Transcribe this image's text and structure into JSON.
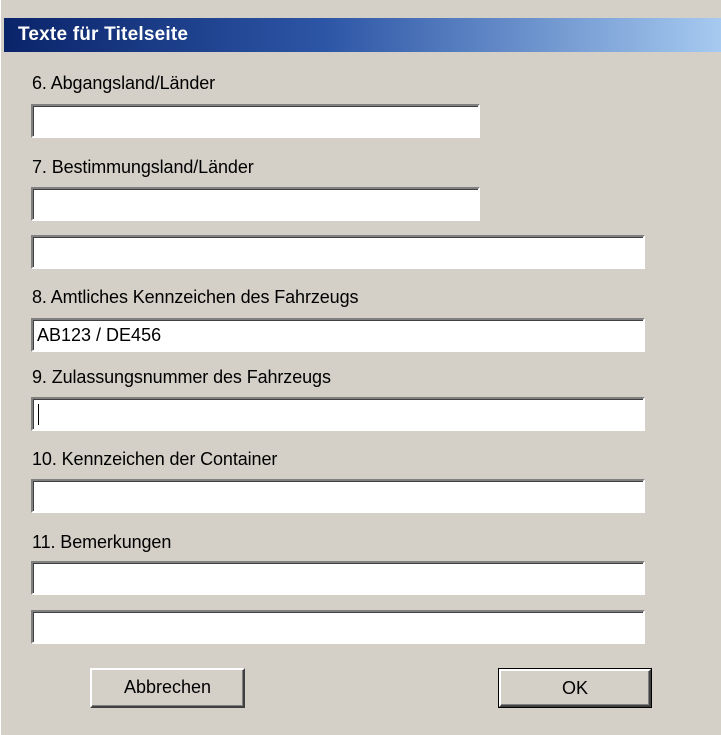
{
  "window": {
    "title": "Texte für Titelseite"
  },
  "fields": {
    "departure_label": "6. Abgangsland/Länder",
    "departure_value": "",
    "destination_label": "7. Bestimmungsland/Länder",
    "destination_value_1": "",
    "destination_value_2": "",
    "vehicle_plate_label": "8. Amtliches Kennzeichen des Fahrzeugs",
    "vehicle_plate_value": "AB123 / DE456",
    "vehicle_registration_label": "9. Zulassungsnummer des Fahrzeugs",
    "vehicle_registration_value": "",
    "container_label": "10. Kennzeichen der Container",
    "container_value": "",
    "remarks_label": "11. Bemerkungen",
    "remarks_value_1": "",
    "remarks_value_2": ""
  },
  "buttons": {
    "cancel_label": "Abbrechen",
    "ok_label": "OK"
  },
  "colors": {
    "dialog_background": "#d4d0c8",
    "titlebar_start": "#0a246a",
    "titlebar_end": "#a6caf0",
    "title_text": "#ffffff"
  }
}
